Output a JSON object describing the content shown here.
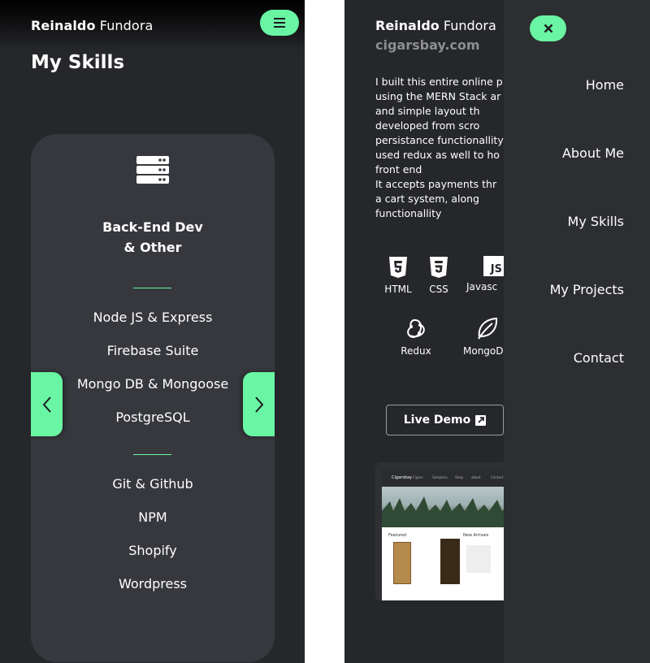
{
  "left": {
    "brand_bold": "Reinaldo",
    "brand_light": "Fundora",
    "page_title": "My Skills",
    "card": {
      "icon": "server-icon",
      "title_line1": "Back-End Dev",
      "title_line2": "& Other",
      "group1": [
        "Node JS & Express",
        "Firebase Suite",
        "Mongo DB & Mongoose",
        "PostgreSQL"
      ],
      "group2": [
        "Git & Github",
        "NPM",
        "Shopify",
        "Wordpress"
      ]
    }
  },
  "right": {
    "brand_bold": "Reinaldo",
    "brand_light": "Fundora",
    "project_title": "cigarsbay.com",
    "description_lines": [
      "I built this entire online p",
      "using the MERN Stack ar",
      "and  simple  layout  th",
      "developed  from  scro",
      "persistance functionallity",
      "used redux as well to ho",
      "front end",
      "It accepts payments thr",
      "a  cart  system,  along",
      "functionallity"
    ],
    "tech": [
      "HTML",
      "CSS",
      "Javasc",
      "Redux",
      "MongoD"
    ],
    "js_badge": "JS",
    "demo_label": "Live Demo",
    "preview": {
      "site_name": "Cigarsbay",
      "nav": [
        "Cigars",
        "Samplers",
        "Shop",
        "about",
        "Contact"
      ],
      "featured": "Featured",
      "new_arrivals": "New Arrivals"
    }
  },
  "drawer": {
    "items": [
      "Home",
      "About Me",
      "My Skills",
      "My Projects",
      "Contact"
    ]
  },
  "colors": {
    "accent": "#6af5a4",
    "background": "#26272b",
    "card": "#37383d",
    "drawer": "#2d2e31"
  }
}
